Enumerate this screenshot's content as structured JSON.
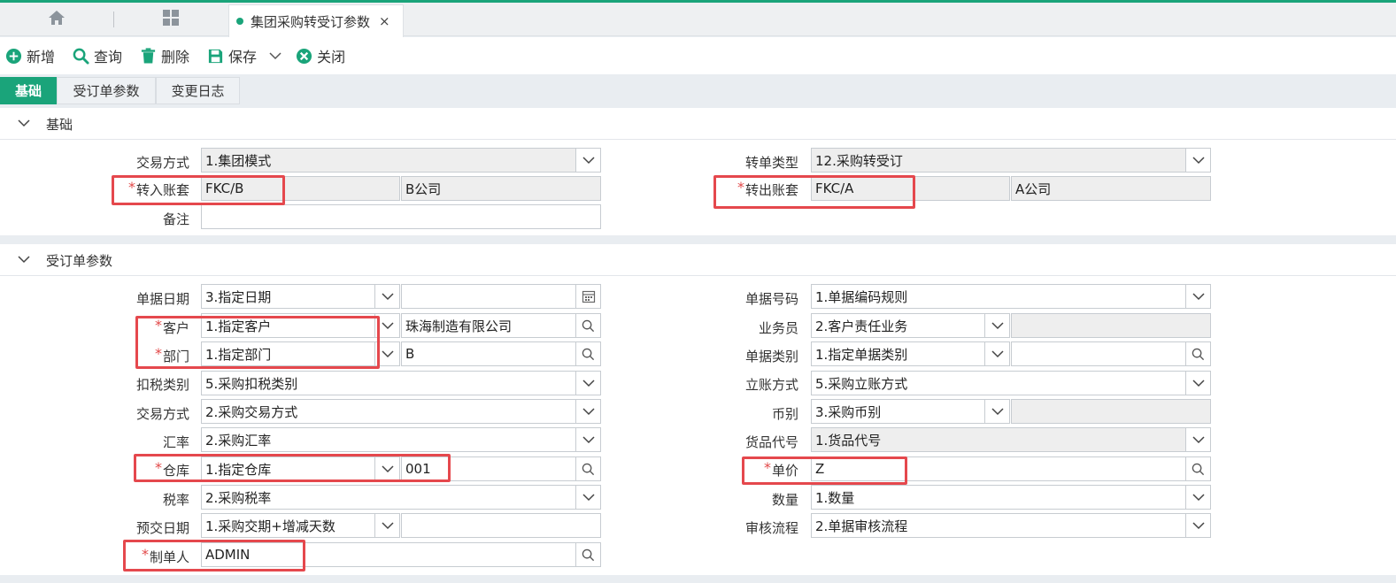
{
  "accent": "#1aa47a",
  "highlight_color": "#e5484d",
  "tabs": {
    "home_icon": "home-icon",
    "apps_icon": "grid-icon",
    "active_title": "集团采购转受订参数",
    "close": "×"
  },
  "toolbar": {
    "add": "新增",
    "query": "查询",
    "delete": "删除",
    "save": "保存",
    "close": "关闭"
  },
  "subtabs": [
    "基础",
    "受订单参数",
    "变更日志"
  ],
  "basic": {
    "title": "基础",
    "trade_mode_label": "交易方式",
    "trade_mode_value": "1.集团模式",
    "convert_type_label": "转单类型",
    "convert_type_value": "12.采购转受订",
    "in_account_label": "转入账套",
    "in_account_code": "FKC/B",
    "in_account_name": "B公司",
    "out_account_label": "转出账套",
    "out_account_code": "FKC/A",
    "out_account_name": "A公司",
    "remark_label": "备注",
    "remark_value": ""
  },
  "order": {
    "title": "受订单参数",
    "left": {
      "date_label": "单据日期",
      "date_value": "3.指定日期",
      "date_extra": "",
      "customer_label": "客户",
      "customer_value": "1.指定客户",
      "customer_extra": "珠海制造有限公司",
      "dept_label": "部门",
      "dept_value": "1.指定部门",
      "dept_extra": "B",
      "tax_cat_label": "扣税类别",
      "tax_cat_value": "5.采购扣税类别",
      "trade_label": "交易方式",
      "trade_value": "2.采购交易方式",
      "rate_label": "汇率",
      "rate_value": "2.采购汇率",
      "warehouse_label": "仓库",
      "warehouse_value": "1.指定仓库",
      "warehouse_extra": "001",
      "taxrate_label": "税率",
      "taxrate_value": "2.采购税率",
      "predate_label": "预交日期",
      "predate_value": "1.采购交期+增减天数",
      "predate_extra": "",
      "maker_label": "制单人",
      "maker_value": "ADMIN"
    },
    "right": {
      "docno_label": "单据号码",
      "docno_value": "1.单据编码规则",
      "sales_label": "业务员",
      "sales_value": "2.客户责任业务",
      "sales_extra": "",
      "doccat_label": "单据类别",
      "doccat_value": "1.指定单据类别",
      "doccat_extra": "",
      "account_label": "立账方式",
      "account_value": "5.采购立账方式",
      "currency_label": "币别",
      "currency_value": "3.采购币别",
      "currency_extra": "",
      "goods_label": "货品代号",
      "goods_value": "1.货品代号",
      "price_label": "单价",
      "price_value": "Z",
      "qty_label": "数量",
      "qty_value": "1.数量",
      "flow_label": "审核流程",
      "flow_value": "2.单据审核流程"
    }
  },
  "required_mark": "*"
}
